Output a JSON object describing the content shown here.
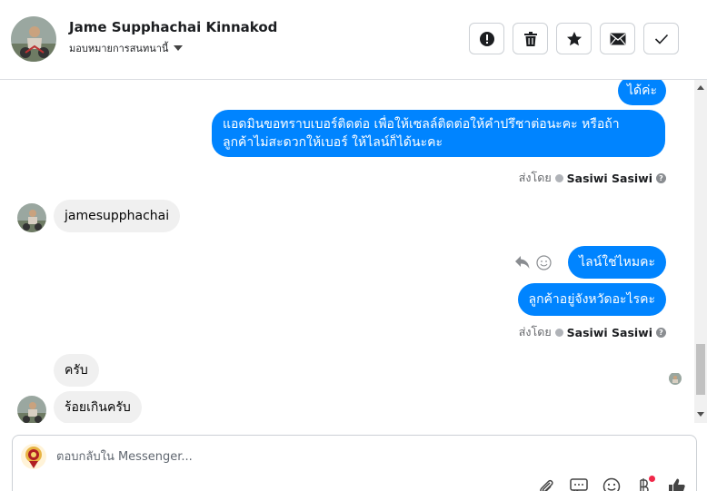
{
  "header": {
    "contact_name": "Jame Supphachai Kinnakod",
    "assign_label": "มอบหมายการสนทนานี้",
    "actions": [
      {
        "name": "report-button",
        "icon": "exclamation-icon"
      },
      {
        "name": "delete-button",
        "icon": "trash-icon"
      },
      {
        "name": "star-button",
        "icon": "star-icon"
      },
      {
        "name": "mark-unread-button",
        "icon": "envelope-icon"
      },
      {
        "name": "mark-done-button",
        "icon": "check-icon"
      }
    ]
  },
  "conversation": {
    "messages": [
      {
        "direction": "out",
        "text": "ได้ค่ะ"
      },
      {
        "direction": "out",
        "text_line1": "แอดมินขอทราบเบอร์ติดต่อ เพื่อให้เซลล์ติดต่อให้คำปรึชาต่อนะคะ หรือถ้า",
        "text_line2": "ลูกค้าไม่สะดวกให้เบอร์ ให้ไลน์ก็ได้นะคะ"
      },
      {
        "direction": "in",
        "text": "jamesupphachai"
      },
      {
        "direction": "out",
        "text": "ไลน์ใช่ไหมคะ"
      },
      {
        "direction": "out",
        "text": "ลูกค้าอยู่จังหวัดอะไรคะ"
      },
      {
        "direction": "in",
        "text": "ครับ"
      },
      {
        "direction": "in",
        "text": "ร้อยเกินครับ"
      }
    ],
    "sent_by_prefix": "ส่งโดย",
    "sent_by_name": "Sasiwi Sasiwi",
    "help_glyph": "?"
  },
  "composer": {
    "placeholder": "ตอบกลับใน Messenger..."
  },
  "colors": {
    "outgoing_bubble": "#0084ff",
    "incoming_bubble": "#f0f0f0",
    "notification_dot": "#f02849"
  }
}
